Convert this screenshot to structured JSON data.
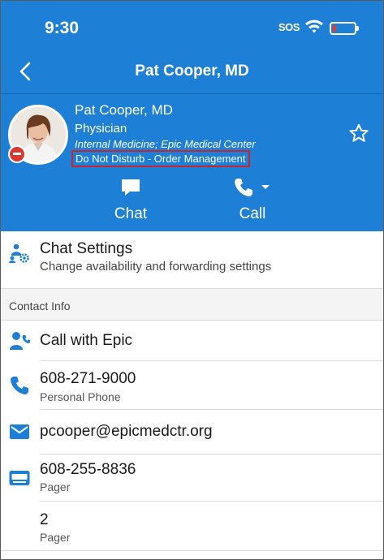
{
  "status_bar": {
    "time": "9:30",
    "sos": "SOS"
  },
  "nav": {
    "title": "Pat Cooper, MD"
  },
  "profile": {
    "name": "Pat Cooper, MD",
    "role": "Physician",
    "department": "Internal Medicine; Epic Medical Center",
    "status": "Do Not Disturb - Order Management"
  },
  "actions": {
    "chat_label": "Chat",
    "call_label": "Call"
  },
  "chat_settings": {
    "title": "Chat Settings",
    "subtitle": "Change availability and forwarding settings"
  },
  "contact_info": {
    "header": "Contact Info",
    "items": [
      {
        "label": "Call with Epic",
        "icon": "call-with-epic-icon"
      },
      {
        "label": "608-271-9000",
        "sub": "Personal Phone",
        "icon": "phone-icon"
      },
      {
        "label": "pcooper@epicmedctr.org",
        "icon": "email-icon"
      },
      {
        "label": "608-255-8836",
        "sub": "Pager",
        "icon": "pager-icon"
      },
      {
        "label": "2",
        "sub": "Pager"
      }
    ]
  },
  "colors": {
    "brand_blue": "#1e7fd6",
    "dnd_red": "#d93a2f",
    "highlight_border": "#c8262d"
  }
}
